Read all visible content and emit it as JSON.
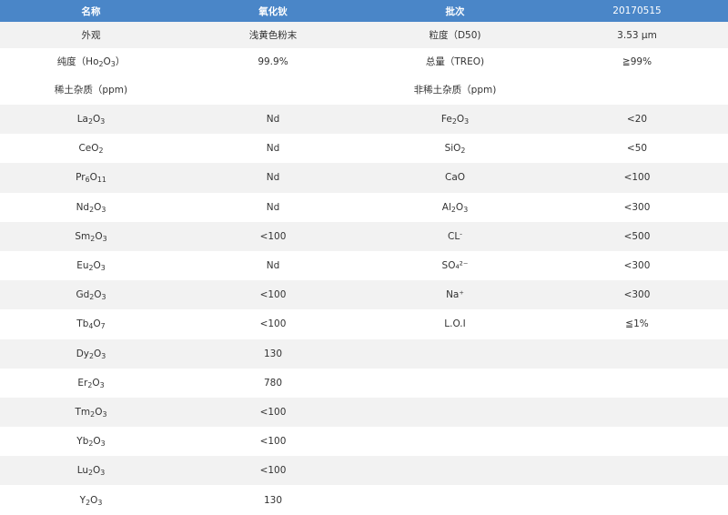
{
  "header": {
    "name_label": "名称",
    "product_name": "氧化钬",
    "batch_label": "批次",
    "batch_value": "20170515"
  },
  "info": {
    "appearance_label": "外观",
    "appearance_value": "浅黄色粉末",
    "particle_label": "粒度（D50)",
    "particle_value": "3.53 μm",
    "purity_label_pre": "纯度（Ho",
    "purity_label_sub1": "2",
    "purity_label_mid": "O",
    "purity_label_sub2": "3",
    "purity_label_post": "）",
    "purity_value": "99.9%",
    "treo_label": "总量（TREO)",
    "treo_value": "≧99%"
  },
  "sections": {
    "re_impurities": "稀土杂质（ppm)",
    "non_re_impurities": "非稀土杂质（ppm)"
  },
  "re_rows": [
    {
      "parts": [
        [
          "La",
          ""
        ],
        [
          "2",
          "sub"
        ],
        [
          "O",
          ""
        ],
        [
          "3",
          "sub"
        ]
      ],
      "value": "Nd"
    },
    {
      "parts": [
        [
          "CeO",
          ""
        ],
        [
          "2",
          "sub"
        ]
      ],
      "value": "Nd"
    },
    {
      "parts": [
        [
          "Pr",
          ""
        ],
        [
          "6",
          "sub"
        ],
        [
          "O",
          ""
        ],
        [
          "11",
          "sub"
        ]
      ],
      "value": "Nd"
    },
    {
      "parts": [
        [
          "Nd",
          ""
        ],
        [
          "2",
          "sub"
        ],
        [
          "O",
          ""
        ],
        [
          "3",
          "sub"
        ]
      ],
      "value": "Nd"
    },
    {
      "parts": [
        [
          "Sm",
          ""
        ],
        [
          "2",
          "sub"
        ],
        [
          "O",
          ""
        ],
        [
          "3",
          "sub"
        ]
      ],
      "value": "<100"
    },
    {
      "parts": [
        [
          "Eu",
          ""
        ],
        [
          "2",
          "sub"
        ],
        [
          "O",
          ""
        ],
        [
          "3",
          "sub"
        ]
      ],
      "value": "Nd"
    },
    {
      "parts": [
        [
          "Gd",
          ""
        ],
        [
          "2",
          "sub"
        ],
        [
          "O",
          ""
        ],
        [
          "3",
          "sub"
        ]
      ],
      "value": "<100"
    },
    {
      "parts": [
        [
          "Tb",
          ""
        ],
        [
          "4",
          "sub"
        ],
        [
          "O",
          ""
        ],
        [
          "7",
          "sub"
        ]
      ],
      "value": "<100"
    },
    {
      "parts": [
        [
          "Dy",
          ""
        ],
        [
          "2",
          "sub"
        ],
        [
          "O",
          ""
        ],
        [
          "3",
          "sub"
        ]
      ],
      "value": "130"
    },
    {
      "parts": [
        [
          "Er",
          ""
        ],
        [
          "2",
          "sub"
        ],
        [
          "O",
          ""
        ],
        [
          "3",
          "sub"
        ]
      ],
      "value": "780"
    },
    {
      "parts": [
        [
          "Tm",
          ""
        ],
        [
          "2",
          "sub"
        ],
        [
          "O",
          ""
        ],
        [
          "3",
          "sub"
        ]
      ],
      "value": "<100"
    },
    {
      "parts": [
        [
          "Yb",
          ""
        ],
        [
          "2",
          "sub"
        ],
        [
          "O",
          ""
        ],
        [
          "3",
          "sub"
        ]
      ],
      "value": "<100"
    },
    {
      "parts": [
        [
          "Lu",
          ""
        ],
        [
          "2",
          "sub"
        ],
        [
          "O",
          ""
        ],
        [
          "3",
          "sub"
        ]
      ],
      "value": "<100"
    },
    {
      "parts": [
        [
          "Y",
          ""
        ],
        [
          "2",
          "sub"
        ],
        [
          "O",
          ""
        ],
        [
          "3",
          "sub"
        ]
      ],
      "value": "130"
    }
  ],
  "non_re_rows": [
    {
      "parts": [
        [
          "Fe",
          ""
        ],
        [
          "2",
          "sub"
        ],
        [
          "O",
          ""
        ],
        [
          "3",
          "sub"
        ]
      ],
      "value": "<20"
    },
    {
      "parts": [
        [
          "SiO",
          ""
        ],
        [
          "2",
          "sub"
        ]
      ],
      "value": "<50"
    },
    {
      "parts": [
        [
          "CaO",
          ""
        ]
      ],
      "value": "<100"
    },
    {
      "parts": [
        [
          "Al",
          ""
        ],
        [
          "2",
          "sub"
        ],
        [
          "O",
          ""
        ],
        [
          "3",
          "sub"
        ]
      ],
      "value": "<300"
    },
    {
      "parts": [
        [
          "CL",
          ""
        ],
        [
          "-",
          "sup"
        ]
      ],
      "value": "<500"
    },
    {
      "parts": [
        [
          "SO₄²⁻",
          ""
        ]
      ],
      "value": "<300"
    },
    {
      "parts": [
        [
          "Na⁺",
          ""
        ]
      ],
      "value": "<300"
    },
    {
      "parts": [
        [
          "L.O.I",
          ""
        ]
      ],
      "value": "≦1%"
    }
  ],
  "colors": {
    "header_bg": "#4a86c8",
    "header_text": "#ffffff",
    "zebra_bg": "#f2f2f2"
  }
}
